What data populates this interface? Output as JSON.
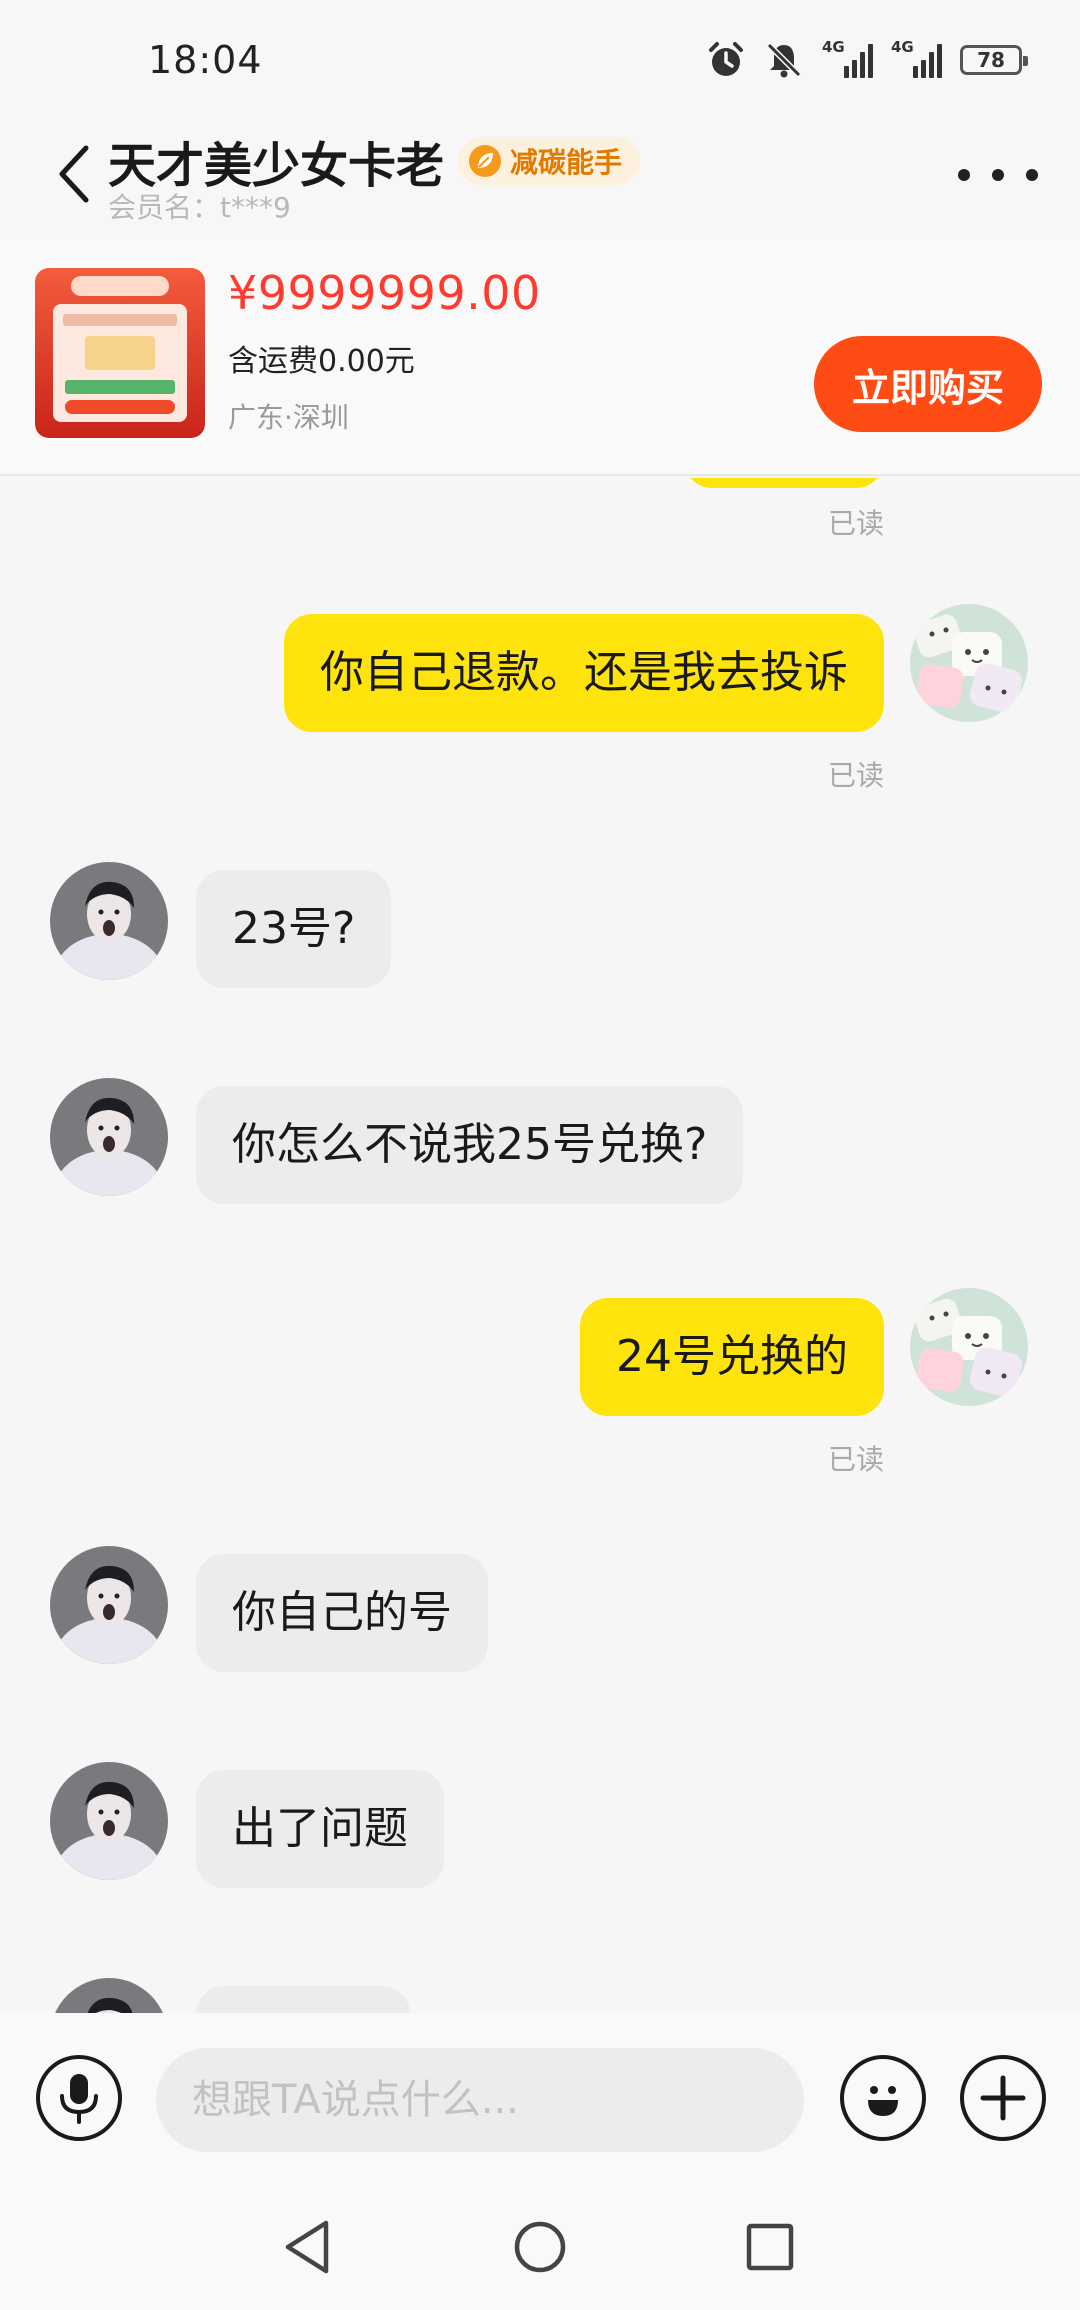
{
  "status_bar": {
    "time": "18:04",
    "network_1": "4G",
    "network_2": "4G",
    "battery": "78",
    "icons": [
      "alarm-icon",
      "mute-bell-icon",
      "signal-icon",
      "signal-icon",
      "battery-icon"
    ]
  },
  "header": {
    "title": "天才美少女卡老",
    "badge": "减碳能手",
    "member_label": "会员名：t***9",
    "icons": [
      "back-arrow-icon",
      "leaf-icon",
      "more-icon"
    ]
  },
  "product": {
    "price": "¥9999999.00",
    "shipping": "含运费0.00元",
    "location": "广东·深圳",
    "buy_label": "立即购买"
  },
  "messages": [
    {
      "side": "self",
      "text": "",
      "read": "已读",
      "partial": true
    },
    {
      "side": "self",
      "text": "你自己退款。还是我去投诉",
      "read": "已读"
    },
    {
      "side": "other",
      "text": "23号?"
    },
    {
      "side": "other",
      "text": "你怎么不说我25号兑换?"
    },
    {
      "side": "self",
      "text": "24号兑换的",
      "read": "已读"
    },
    {
      "side": "other",
      "text": "你自己的号"
    },
    {
      "side": "other",
      "text": "出了问题"
    },
    {
      "side": "other",
      "text": "",
      "partial": true
    }
  ],
  "input": {
    "placeholder": "想跟TA说点什么..."
  },
  "input_icons": [
    "microphone-icon",
    "emoji-icon",
    "plus-icon"
  ],
  "nav": [
    "nav-back-icon",
    "nav-home-icon",
    "nav-recents-icon"
  ],
  "colors": {
    "accent": "#ff4b14",
    "price": "#ff3b30",
    "self_bubble": "#ffe30d",
    "other_bubble": "#ececec",
    "badge_text": "#e07a00"
  }
}
